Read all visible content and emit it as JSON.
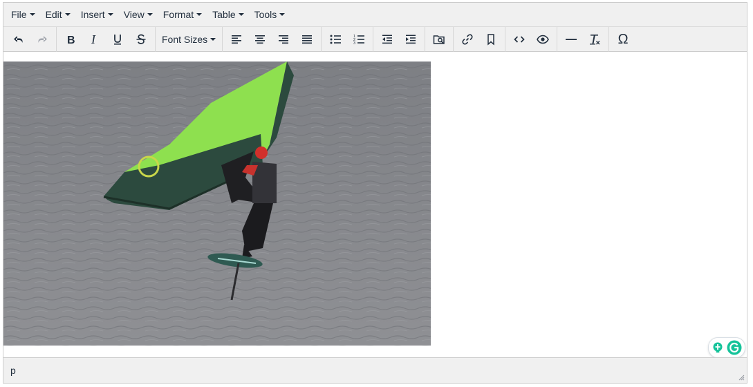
{
  "menubar": {
    "items": [
      {
        "label": "File"
      },
      {
        "label": "Edit"
      },
      {
        "label": "Insert"
      },
      {
        "label": "View"
      },
      {
        "label": "Format"
      },
      {
        "label": "Table"
      },
      {
        "label": "Tools"
      }
    ]
  },
  "toolbar": {
    "font_sizes_label": "Font Sizes",
    "special_char_glyph": "Ω",
    "undo_enabled": true,
    "redo_enabled": false
  },
  "content": {
    "image_subject": "wing-foiler-on-water"
  },
  "statusbar": {
    "path": "p"
  },
  "colors": {
    "chrome_bg": "#f0f0f0",
    "text": "#222f3e",
    "disabled": "#a5a9b0",
    "wing_green": "#8ee04f",
    "wing_dark": "#2c4a3e",
    "water": "#8a8c90",
    "grammarly_green": "#15c39a"
  }
}
